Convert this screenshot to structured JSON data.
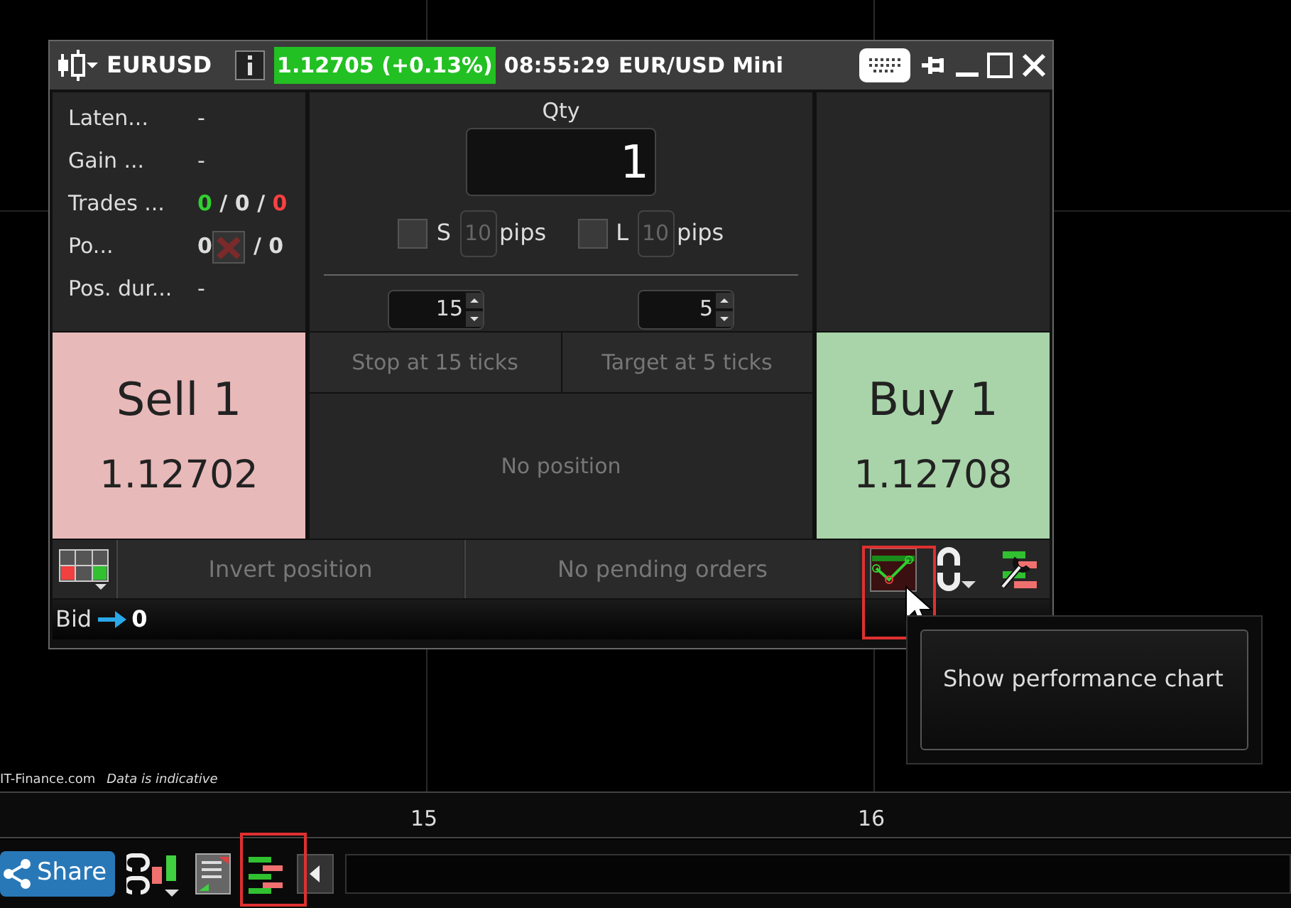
{
  "window": {
    "symbol": "EURUSD",
    "price_change": "1.12705 (+0.13%)",
    "time": "08:55:29",
    "instrument": "EUR/USD Mini"
  },
  "stats": [
    {
      "label": "Laten...",
      "kind": "text",
      "value": "-"
    },
    {
      "label": "Gain ...",
      "kind": "text",
      "value": "-"
    },
    {
      "label": "Trades ...",
      "kind": "trades",
      "won": "0",
      "separator_1": "/",
      "even": "0",
      "separator_2": "/",
      "lost": "0"
    },
    {
      "label": "Po...",
      "kind": "position",
      "value": "0",
      "rest": "/ 0"
    },
    {
      "label": "Pos. dur...",
      "kind": "text",
      "value": "-"
    }
  ],
  "qty": {
    "label": "Qty",
    "value": "1"
  },
  "brackets": [
    {
      "label": "S",
      "checked": false,
      "value": "10",
      "disabled": true,
      "unit": "pips"
    },
    {
      "label": "L",
      "checked": false,
      "value": "10",
      "disabled": true,
      "unit": "pips"
    }
  ],
  "spinners": [
    "15",
    "5"
  ],
  "sell": {
    "label": "Sell 1",
    "price": "1.12702"
  },
  "buy": {
    "label": "Buy 1",
    "price": "1.12708"
  },
  "stop_button": "Stop at 15 ticks",
  "target_button": "Target at 5 ticks",
  "position_status": "No position",
  "toolbar": {
    "invert": "Invert position",
    "orders": "No pending orders"
  },
  "bid": {
    "label": "Bid",
    "value": "0"
  },
  "tooltip": "Show performance chart",
  "footer": {
    "site": "IT-Finance.com",
    "note": "Data is indicative"
  },
  "axis_labels": [
    "15",
    "16"
  ],
  "bottom_bar": {
    "share": "Share"
  }
}
